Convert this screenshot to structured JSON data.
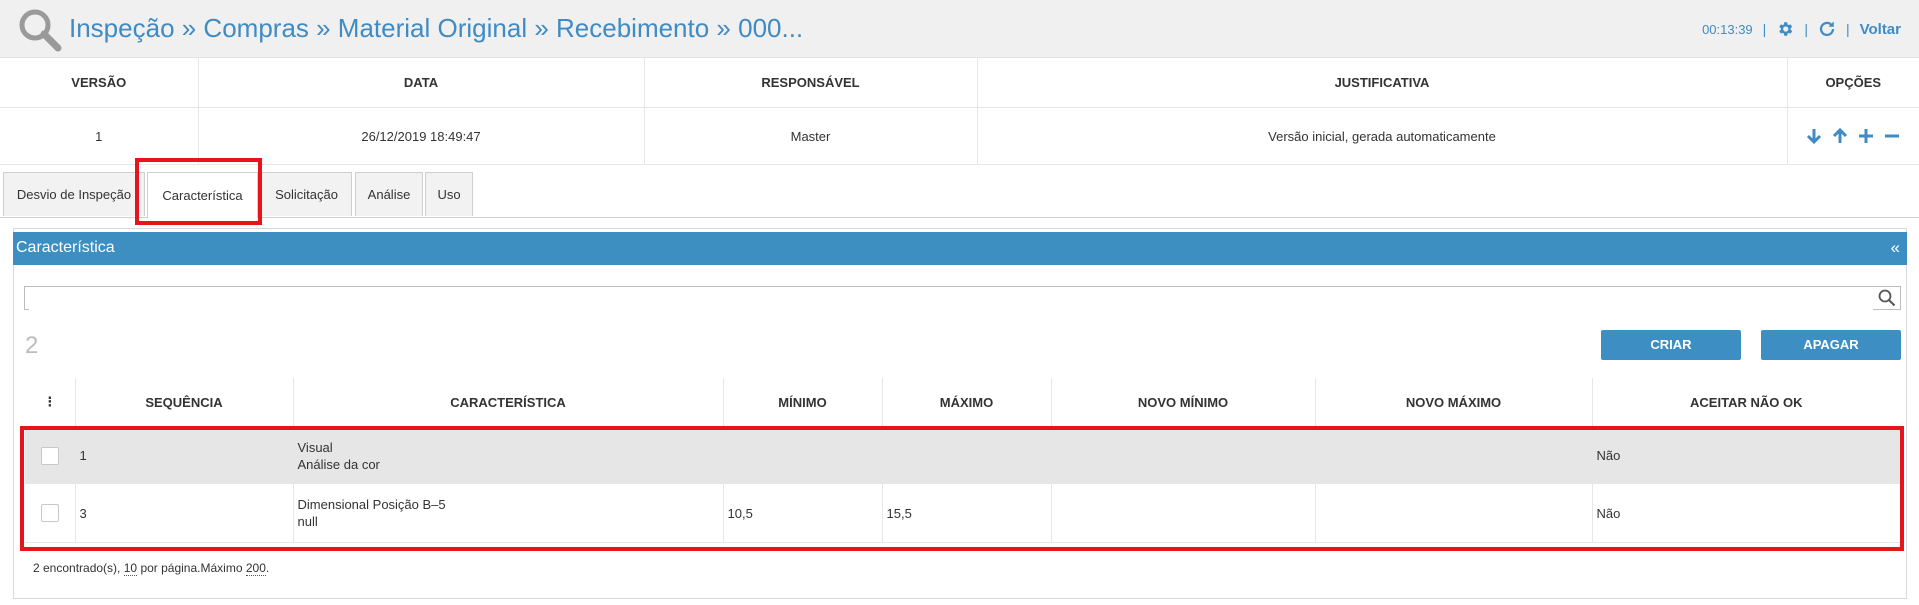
{
  "header": {
    "breadcrumb": "Inspeção » Compras » Material Original » Recebimento » 000...",
    "timer": "00:13:39",
    "sep": "|",
    "back_label": "Voltar"
  },
  "versions": {
    "columns": [
      "VERSÃO",
      "DATA",
      "RESPONSÁVEL",
      "JUSTIFICATIVA",
      "OPÇÕES"
    ],
    "row": {
      "version": "1",
      "date": "26/12/2019 18:49:47",
      "responsible": "Master",
      "justification": "Versão inicial, gerada automaticamente"
    }
  },
  "tabs": [
    {
      "label": "Desvio de Inspeção"
    },
    {
      "label": "Característica"
    },
    {
      "label": "Solicitação"
    },
    {
      "label": "Análise"
    },
    {
      "label": "Uso"
    }
  ],
  "panel": {
    "title": "Característica",
    "collapse": "«",
    "search_placeholder": "",
    "count": "2",
    "create_label": "CRIAR",
    "delete_label": "APAGAR"
  },
  "table": {
    "menu": "⋮",
    "columns": [
      "SEQUÊNCIA",
      "CARACTERÍSTICA",
      "MÍNIMO",
      "MÁXIMO",
      "NOVO MÍNIMO",
      "NOVO MÁXIMO",
      "ACEITAR NÃO OK"
    ],
    "rows": [
      {
        "seq": "1",
        "char_line1": "Visual",
        "char_line2": "Análise da cor",
        "min": "",
        "max": "",
        "new_min": "",
        "new_max": "",
        "accept": "Não"
      },
      {
        "seq": "3",
        "char_line1": "Dimensional Posição B–5",
        "char_line2": "null",
        "min": "10,5",
        "max": "15,5",
        "new_min": "",
        "new_max": "",
        "accept": "Não"
      }
    ]
  },
  "footer": {
    "found": "2 encontrado(s),",
    "per_page_num": "10",
    "per_page_text": "por página.Máximo",
    "max_num": "200",
    "end": "."
  },
  "colors": {
    "accent": "#3c8fc0",
    "highlight": "#e8141c"
  }
}
